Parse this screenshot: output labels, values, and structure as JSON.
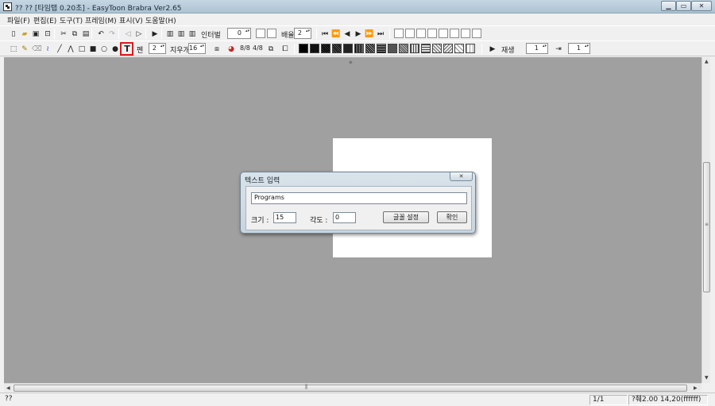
{
  "window": {
    "title": "?? ?? [타임탭 0.20초] - EasyToon Brabra  Ver2.65",
    "minimize_glyph": "▁",
    "maximize_glyph": "▭",
    "close_glyph": "✕"
  },
  "menu": {
    "items": [
      "파일(F)",
      "편집(E)",
      "도구(T)",
      "프레임(M)",
      "표시(V)",
      "도움말(H)"
    ]
  },
  "toolbar1": {
    "interval_label": "인터벌",
    "interval_value": "0",
    "scale_label": "배율",
    "scale_value": "2"
  },
  "toolbar2": {
    "pen_label": "펜",
    "pen_value": "2",
    "eraser_label": "지우개",
    "eraser_value": "16",
    "ratio1": "8/8",
    "ratio2": "4/8",
    "play_label": "재생",
    "play_value": "1",
    "frame_value": "1"
  },
  "icons": {
    "new": "new-file-icon",
    "open": "open-folder-icon",
    "save": "save-icon",
    "text_tool": "text-tool-icon"
  },
  "dialog": {
    "title": "텍스트 입력",
    "close_glyph": "✕",
    "text_value": "Programs",
    "size_label": "크기 :",
    "size_value": "15",
    "angle_label": "각도 :",
    "angle_value": "0",
    "font_button": "글꼴 설정",
    "ok_button": "확인"
  },
  "status": {
    "left": "??",
    "page": "1/1",
    "info": "?췌2.00  14,20(ffffff)"
  },
  "colors": {
    "workspace": "#a0a0a0",
    "canvas": "#ffffff",
    "highlight": "#e0191d"
  }
}
